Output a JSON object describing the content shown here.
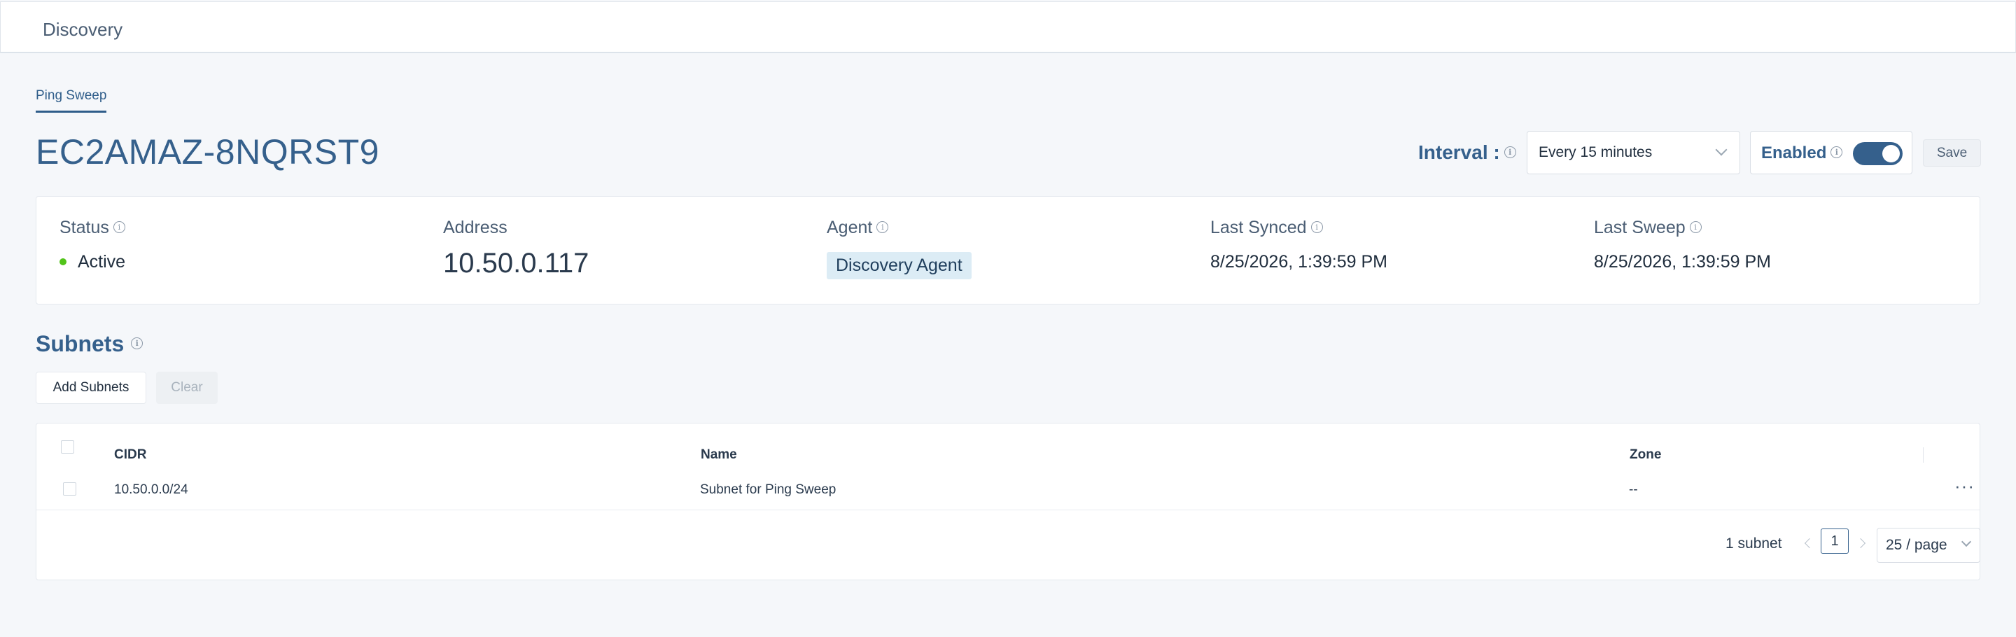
{
  "topbar": {
    "title": "Discovery"
  },
  "tabs": [
    {
      "label": "Ping Sweep",
      "active": true
    }
  ],
  "header": {
    "title": "EC2AMAZ-8NQRST9",
    "interval_label": "Interval :",
    "interval_value": "Every 15 minutes",
    "enabled_label": "Enabled",
    "enabled_state": true,
    "save_label": "Save"
  },
  "status_card": {
    "status": {
      "label": "Status",
      "value": "Active"
    },
    "address": {
      "label": "Address",
      "value": "10.50.0.117"
    },
    "agent": {
      "label": "Agent",
      "value": "Discovery Agent"
    },
    "last_synced": {
      "label": "Last Synced",
      "value": "8/25/2026, 1:39:59 PM"
    },
    "last_sweep": {
      "label": "Last Sweep",
      "value": "8/25/2026, 1:39:59 PM"
    }
  },
  "subnets": {
    "title": "Subnets",
    "add_label": "Add Subnets",
    "clear_label": "Clear",
    "columns": [
      "CIDR",
      "Name",
      "Zone"
    ],
    "rows": [
      {
        "cidr": "10.50.0.0/24",
        "name": "Subnet for Ping Sweep",
        "zone": "--"
      }
    ],
    "pagination": {
      "count_text": "1 subnet",
      "current_page": "1",
      "page_size": "25 / page"
    }
  },
  "colors": {
    "accent": "#35608c",
    "status_active": "#52c41a",
    "agent_tag_bg": "#dcecf5"
  }
}
